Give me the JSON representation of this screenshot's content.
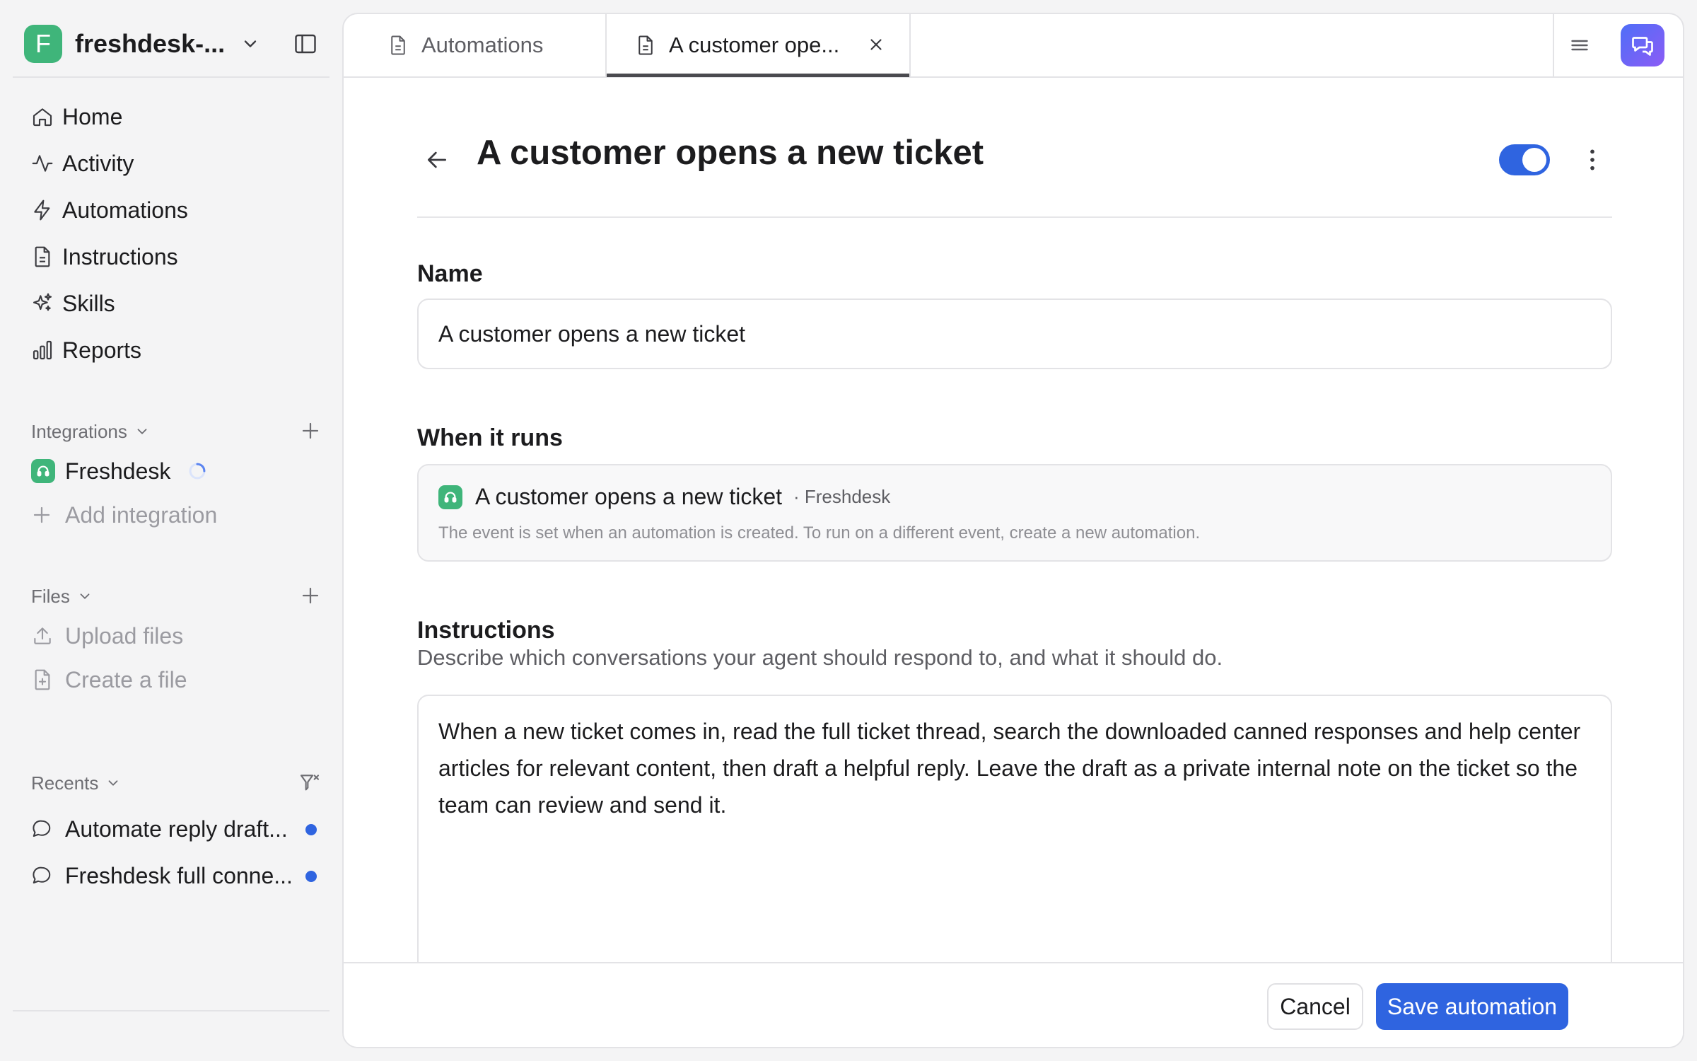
{
  "workspace": {
    "initial": "F",
    "name": "freshdesk-...",
    "avatar_color": "#3fb57a"
  },
  "nav": {
    "items": [
      {
        "label": "Home",
        "icon": "home-icon"
      },
      {
        "label": "Activity",
        "icon": "activity-icon"
      },
      {
        "label": "Automations",
        "icon": "lightning-icon"
      },
      {
        "label": "Instructions",
        "icon": "document-icon"
      },
      {
        "label": "Skills",
        "icon": "sparkles-icon"
      },
      {
        "label": "Reports",
        "icon": "bar-chart-icon"
      }
    ]
  },
  "integrations": {
    "header": "Integrations",
    "items": [
      {
        "label": "Freshdesk",
        "icon": "freshdesk-headset-icon",
        "status": "loading"
      }
    ],
    "add_label": "Add integration"
  },
  "files": {
    "header": "Files",
    "upload_label": "Upload files",
    "create_label": "Create a file"
  },
  "recents": {
    "header": "Recents",
    "items": [
      {
        "label": "Automate reply draft...",
        "unread": true
      },
      {
        "label": "Freshdesk full conne...",
        "unread": true
      }
    ]
  },
  "tabs": [
    {
      "label": "Automations",
      "active": false
    },
    {
      "label": "A customer ope...",
      "active": true
    }
  ],
  "automation": {
    "title": "A customer opens a new ticket",
    "enabled": true,
    "name_label": "Name",
    "name_value": "A customer opens a new ticket",
    "when_label": "When it runs",
    "trigger": {
      "title": "A customer opens a new ticket",
      "app": "· Freshdesk",
      "note": "The event is set when an automation is created. To run on a different event, create a new automation."
    },
    "instructions_label": "Instructions",
    "instructions_desc": "Describe which conversations your agent should respond to, and what it should do.",
    "instructions_text": "When a new ticket comes in, read the full ticket thread, search the downloaded canned responses and help center articles for relevant content, then draft a helpful reply. Leave the draft as a private internal note on the ticket so the team can review and send it."
  },
  "footer": {
    "cancel_label": "Cancel",
    "save_label": "Save automation"
  },
  "colors": {
    "accent": "#2f64e0",
    "brand_green": "#3fb57a",
    "chat_gradient": [
      "#4f6ef7",
      "#8b5cf6"
    ]
  }
}
